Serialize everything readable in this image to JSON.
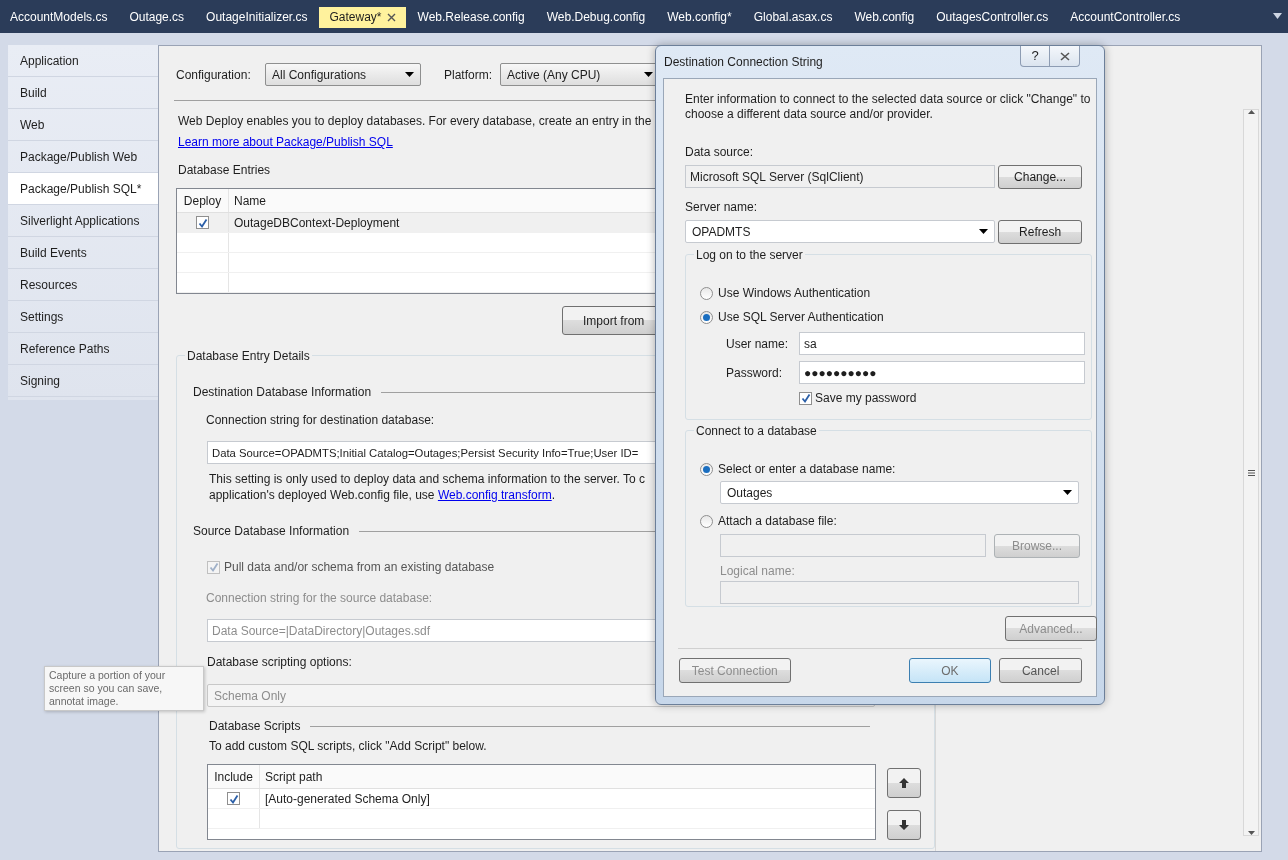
{
  "document_tabs": [
    {
      "label": "AccountModels.cs",
      "selected": false
    },
    {
      "label": "Outage.cs",
      "selected": false
    },
    {
      "label": "OutageInitializer.cs",
      "selected": false
    },
    {
      "label": "Gateway*",
      "selected": true
    },
    {
      "label": "Web.Release.config",
      "selected": false
    },
    {
      "label": "Web.Debug.config",
      "selected": false
    },
    {
      "label": "Web.config*",
      "selected": false
    },
    {
      "label": "Global.asax.cs",
      "selected": false
    },
    {
      "label": "Web.config",
      "selected": false
    },
    {
      "label": "OutagesController.cs",
      "selected": false
    },
    {
      "label": "AccountController.cs",
      "selected": false
    }
  ],
  "sidebar": {
    "items": [
      {
        "label": "Application",
        "selected": false
      },
      {
        "label": "Build",
        "selected": false
      },
      {
        "label": "Web",
        "selected": false
      },
      {
        "label": "Package/Publish Web",
        "selected": false
      },
      {
        "label": "Package/Publish SQL*",
        "selected": true
      },
      {
        "label": "Silverlight Applications",
        "selected": false
      },
      {
        "label": "Build Events",
        "selected": false
      },
      {
        "label": "Resources",
        "selected": false
      },
      {
        "label": "Settings",
        "selected": false
      },
      {
        "label": "Reference Paths",
        "selected": false
      },
      {
        "label": "Signing",
        "selected": false
      }
    ]
  },
  "configuration": {
    "label": "Configuration:",
    "value": "All Configurations"
  },
  "platform": {
    "label": "Platform:",
    "value": "Active (Any CPU)"
  },
  "intro": {
    "text": "Web Deploy enables you to deploy databases. For every database, create an entry in the",
    "link": "Learn more about Package/Publish SQL"
  },
  "database_entries": {
    "title": "Database Entries",
    "columns": [
      "Deploy",
      "Name"
    ],
    "rows": [
      {
        "deploy": true,
        "name": "OutageDBContext-Deployment"
      }
    ]
  },
  "import_button": "Import from",
  "entry_details": {
    "title": "Database Entry Details",
    "destination": {
      "title": "Destination Database Information",
      "connection_label": "Connection string for destination database:",
      "connection_string": "Data Source=OPADMTS;Initial Catalog=Outages;Persist Security Info=True;User ID=",
      "note": "This setting is only used to deploy data and schema information to the server. To c",
      "note_line2": "application's deployed Web.config file, use ",
      "note_link": "Web.config transform",
      "note_end": "."
    },
    "source": {
      "title": "Source Database Information",
      "disabled": true,
      "pull_label": "Pull data and/or schema from an existing database",
      "pull_checked": true,
      "connection_label": "Connection string for the source database:",
      "connection_string": "Data Source=|DataDirectory|Outages.sdf",
      "scripting_label": "Database scripting options:",
      "scripting_value": "Schema Only"
    },
    "scripts": {
      "title": "Database Scripts",
      "hint": "To add custom SQL scripts, click \"Add Script\" below.",
      "columns": [
        "Include",
        "Script path"
      ],
      "rows": [
        {
          "include": true,
          "path": "[Auto-generated Schema Only]"
        }
      ]
    }
  },
  "tooltip": {
    "text": "Capture a portion of your screen so you can save, annotat",
    "line2": "image."
  },
  "dialog": {
    "title": "Destination Connection String",
    "help_button": "?",
    "intro": "Enter information to connect to the selected data source or click \"Change\" to choose a different data source and/or provider.",
    "data_source": {
      "label": "Data source:",
      "value": "Microsoft SQL Server (SqlClient)",
      "button": "Change..."
    },
    "server": {
      "label": "Server name:",
      "value": "OPADMTS",
      "button": "Refresh"
    },
    "logon": {
      "title": "Log on to the server",
      "options": [
        {
          "label": "Use Windows Authentication",
          "selected": false
        },
        {
          "label": "Use SQL Server Authentication",
          "selected": true
        }
      ],
      "user": {
        "label": "User name:",
        "value": "sa"
      },
      "password": {
        "label": "Password:",
        "value": "●●●●●●●●●●"
      },
      "save_password": {
        "label": "Save my password",
        "checked": true
      }
    },
    "database": {
      "title": "Connect to a database",
      "options": [
        {
          "label": "Select or enter a database name:",
          "selected": true
        },
        {
          "label": "Attach a database file:",
          "selected": false
        }
      ],
      "database_name": "Outages",
      "browse_button": "Browse...",
      "logical_name_label": "Logical name:"
    },
    "advanced_button": "Advanced...",
    "buttons": [
      {
        "label": "Test Connection",
        "kind": "test"
      },
      {
        "label": "OK",
        "kind": "default"
      },
      {
        "label": "Cancel",
        "kind": "cancel"
      }
    ]
  }
}
